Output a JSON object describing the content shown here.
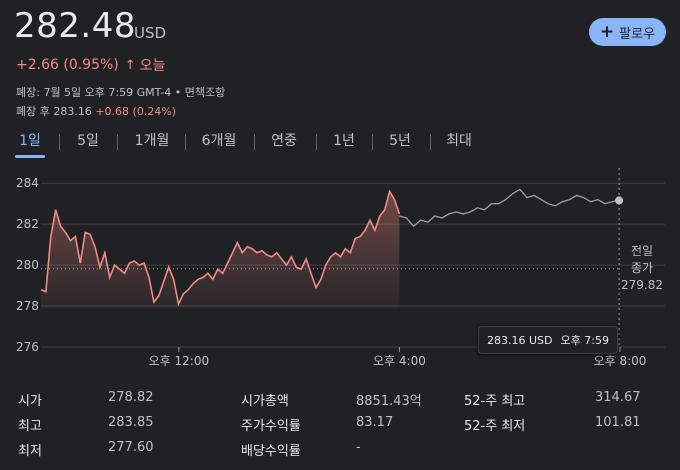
{
  "header": {
    "price": "282.48",
    "currency": "USD",
    "change": "+2.66 (0.95%)",
    "arrow": "↑",
    "period": "오늘",
    "closed_info": "폐장: 7월 5일 오후 7:59 GMT-4 • 면책조항",
    "after_label": "폐장 후 283.16",
    "after_change": "+0.68 (0.24%)",
    "follow_label": "팔로우"
  },
  "tabs": [
    "1일",
    "5일",
    "1개월",
    "6개월",
    "연중",
    "1년",
    "5년",
    "최대"
  ],
  "active_tab": 0,
  "tooltip": {
    "price": "283.16 USD",
    "time": "오후 7:59"
  },
  "prev_close": {
    "label1": "전일",
    "label2": "종가",
    "value": "279.82"
  },
  "colors": {
    "accent": "#8ab4f8",
    "up": "#f28b82",
    "line_regular": "#f28b82",
    "line_after": "#9aa0a6"
  },
  "chart_data": {
    "type": "line",
    "y_ticks": [
      "284",
      "282",
      "280",
      "278",
      "276"
    ],
    "ylim": [
      276,
      284.5
    ],
    "x_ticks": [
      "오후 12:00",
      "오후 4:00",
      "오후 8:00"
    ],
    "previous_close": 279.82,
    "series": [
      {
        "values": [
          278.8,
          278.7,
          281.4,
          282.7,
          281.9,
          281.6,
          281.2,
          281.4,
          280.1,
          281.6,
          281.5,
          280.9,
          279.9,
          280.6,
          279.4,
          280.0,
          279.8,
          279.6,
          280.1,
          280.2,
          280.0,
          280.1,
          279.4,
          278.2,
          278.5,
          279.2,
          279.9,
          279.3,
          278.1,
          278.6,
          278.8,
          279.1,
          279.3,
          279.4,
          279.6,
          279.3,
          279.8,
          279.6,
          280.1,
          280.6,
          281.1,
          280.6,
          280.9,
          280.8,
          280.6,
          280.7,
          280.5,
          280.4,
          280.6,
          280.3,
          280.0,
          280.4,
          279.9,
          279.8,
          280.3,
          279.6,
          278.9,
          279.3,
          280.0,
          280.4,
          280.6,
          280.4,
          280.8,
          280.6,
          281.3,
          281.4,
          281.7,
          282.2,
          281.7,
          282.4,
          282.7,
          283.6,
          283.2,
          282.5
        ],
        "x_range": [
          "09:30",
          "16:00"
        ]
      },
      {
        "values": [
          282.4,
          282.3,
          281.9,
          282.2,
          282.1,
          282.4,
          282.3,
          282.5,
          282.6,
          282.5,
          282.6,
          282.8,
          282.7,
          283.0,
          283.0,
          283.2,
          283.5,
          283.7,
          283.3,
          283.4,
          283.2,
          283.0,
          282.9,
          283.1,
          283.2,
          283.4,
          283.3,
          283.1,
          283.2,
          283.0,
          283.1,
          283.16
        ],
        "x_range": [
          "16:00",
          "19:59"
        ]
      }
    ],
    "last_value": 283.16,
    "last_time": "오후 7:59"
  },
  "stats": {
    "open": {
      "label": "시가",
      "value": "278.82"
    },
    "high": {
      "label": "최고",
      "value": "283.85"
    },
    "low": {
      "label": "최저",
      "value": "277.60"
    },
    "mktcap": {
      "label": "시가총액",
      "value": "8851.43억"
    },
    "pe": {
      "label": "주가수익률",
      "value": "83.17"
    },
    "div": {
      "label": "배당수익률",
      "value": "-"
    },
    "high52": {
      "label": "52-주 최고",
      "value": "314.67"
    },
    "low52": {
      "label": "52-주 최저",
      "value": "101.81"
    }
  }
}
